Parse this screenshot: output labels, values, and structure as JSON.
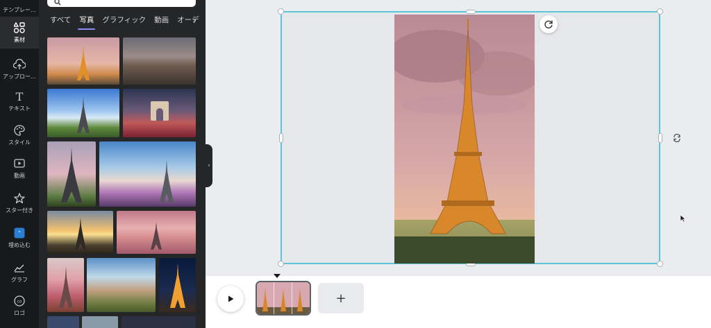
{
  "rail": {
    "items": [
      {
        "label": "テンプレー…",
        "icon": "template-icon"
      },
      {
        "label": "素材",
        "icon": "elements-icon"
      },
      {
        "label": "アップロー…",
        "icon": "upload-icon"
      },
      {
        "label": "テキスト",
        "icon": "text-icon"
      },
      {
        "label": "スタイル",
        "icon": "palette-icon"
      },
      {
        "label": "動画",
        "icon": "video-icon"
      },
      {
        "label": "スター付き",
        "icon": "star-icon"
      },
      {
        "label": "埋め込む",
        "icon": "embed-icon"
      },
      {
        "label": "グラフ",
        "icon": "chart-icon"
      },
      {
        "label": "ロゴ",
        "icon": "logo-icon"
      }
    ]
  },
  "panel": {
    "tabs": [
      {
        "label": "すべて"
      },
      {
        "label": "写真"
      },
      {
        "label": "グラフィック"
      },
      {
        "label": "動画"
      },
      {
        "label": "オーデ"
      }
    ],
    "active_tab": "写真"
  },
  "timeline": {
    "add_label": "+"
  },
  "colors": {
    "selection": "#5bc4d6",
    "rail_bg": "#18191b",
    "panel_bg": "#252627",
    "tab_underline": "#8b8dfd"
  }
}
